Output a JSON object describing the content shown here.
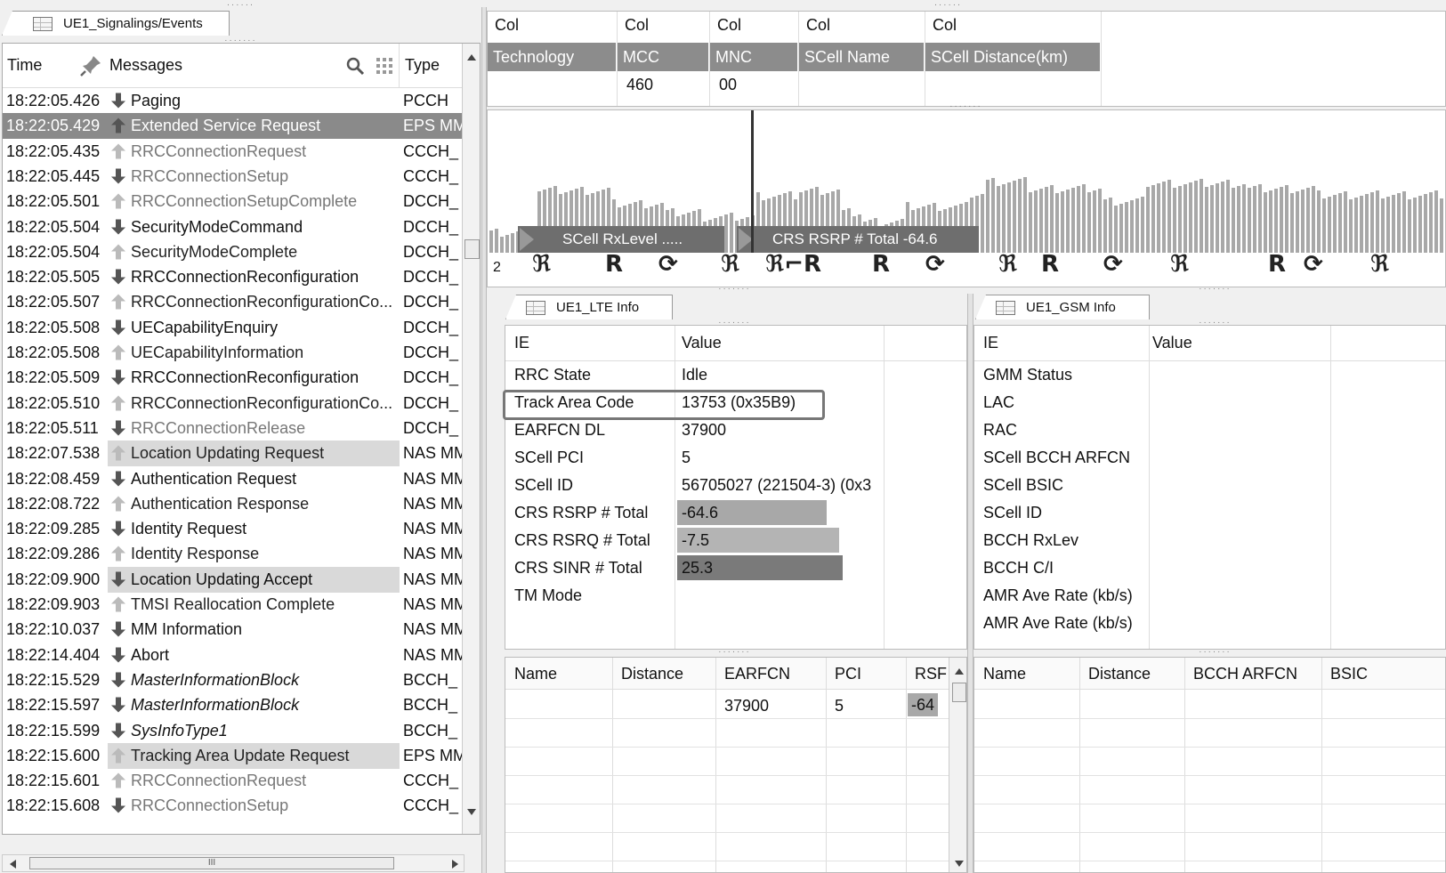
{
  "signaling_panel": {
    "tab_label": "UE1_Signalings/Events",
    "headers": {
      "time": "Time",
      "messages": "Messages",
      "type": "Type"
    },
    "rows": [
      {
        "time": "18:22:05.426",
        "dir": "down",
        "msg": "Paging",
        "type": "PCCH",
        "style": "normal"
      },
      {
        "time": "18:22:05.429",
        "dir": "up",
        "msg": "Extended Service Request",
        "type": "EPS MM",
        "style": "selected"
      },
      {
        "time": "18:22:05.435",
        "dir": "up",
        "msg": "RRCConnectionRequest",
        "type": "CCCH_",
        "style": "grey"
      },
      {
        "time": "18:22:05.445",
        "dir": "down",
        "msg": "RRCConnectionSetup",
        "type": "CCCH_",
        "style": "grey"
      },
      {
        "time": "18:22:05.501",
        "dir": "up",
        "msg": "RRCConnectionSetupComplete",
        "type": "DCCH_",
        "style": "grey"
      },
      {
        "time": "18:22:05.504",
        "dir": "down",
        "msg": "SecurityModeCommand",
        "type": "DCCH_",
        "style": "normal"
      },
      {
        "time": "18:22:05.504",
        "dir": "up",
        "msg": "SecurityModeComplete",
        "type": "DCCH_",
        "style": "normal"
      },
      {
        "time": "18:22:05.505",
        "dir": "down",
        "msg": "RRCConnectionReconfiguration",
        "type": "DCCH_",
        "style": "normal"
      },
      {
        "time": "18:22:05.507",
        "dir": "up",
        "msg": "RRCConnectionReconfigurationCo...",
        "type": "DCCH_",
        "style": "normal"
      },
      {
        "time": "18:22:05.508",
        "dir": "down",
        "msg": "UECapabilityEnquiry",
        "type": "DCCH_",
        "style": "normal"
      },
      {
        "time": "18:22:05.508",
        "dir": "up",
        "msg": "UECapabilityInformation",
        "type": "DCCH_",
        "style": "normal"
      },
      {
        "time": "18:22:05.509",
        "dir": "down",
        "msg": "RRCConnectionReconfiguration",
        "type": "DCCH_",
        "style": "normal"
      },
      {
        "time": "18:22:05.510",
        "dir": "up",
        "msg": "RRCConnectionReconfigurationCo...",
        "type": "DCCH_",
        "style": "normal"
      },
      {
        "time": "18:22:05.511",
        "dir": "down",
        "msg": "RRCConnectionRelease",
        "type": "DCCH_",
        "style": "grey"
      },
      {
        "time": "18:22:07.538",
        "dir": "up",
        "msg": "Location Updating Request",
        "type": "NAS MM",
        "style": "shaded"
      },
      {
        "time": "18:22:08.459",
        "dir": "down",
        "msg": "Authentication Request",
        "type": "NAS MM",
        "style": "normal"
      },
      {
        "time": "18:22:08.722",
        "dir": "up",
        "msg": "Authentication Response",
        "type": "NAS MM",
        "style": "normal"
      },
      {
        "time": "18:22:09.285",
        "dir": "down",
        "msg": "Identity Request",
        "type": "NAS MM",
        "style": "normal"
      },
      {
        "time": "18:22:09.286",
        "dir": "up",
        "msg": "Identity Response",
        "type": "NAS MM",
        "style": "normal"
      },
      {
        "time": "18:22:09.900",
        "dir": "down",
        "msg": "Location Updating Accept",
        "type": "NAS MM",
        "style": "shaded"
      },
      {
        "time": "18:22:09.903",
        "dir": "up",
        "msg": "TMSI Reallocation Complete",
        "type": "NAS MM",
        "style": "normal"
      },
      {
        "time": "18:22:10.037",
        "dir": "down",
        "msg": "MM Information",
        "type": "NAS MM",
        "style": "normal"
      },
      {
        "time": "18:22:14.404",
        "dir": "down",
        "msg": "Abort",
        "type": "NAS MM",
        "style": "normal"
      },
      {
        "time": "18:22:15.529",
        "dir": "down",
        "msg": "MasterInformationBlock",
        "type": "BCCH_",
        "style": "italic"
      },
      {
        "time": "18:22:15.597",
        "dir": "down",
        "msg": "MasterInformationBlock",
        "type": "BCCH_",
        "style": "italic"
      },
      {
        "time": "18:22:15.599",
        "dir": "down",
        "msg": "SysInfoType1",
        "type": "BCCH_",
        "style": "italic"
      },
      {
        "time": "18:22:15.600",
        "dir": "up",
        "msg": "Tracking Area Update Request",
        "type": "EPS MM",
        "style": "shaded"
      },
      {
        "time": "18:22:15.601",
        "dir": "up",
        "msg": "RRCConnectionRequest",
        "type": "CCCH_",
        "style": "grey"
      },
      {
        "time": "18:22:15.608",
        "dir": "down",
        "msg": "RRCConnectionSetup",
        "type": "CCCH_",
        "style": "grey"
      }
    ],
    "hscroll_thumb": "III"
  },
  "cell_table": {
    "col_headers": [
      "Col",
      "Col",
      "Col",
      "Col",
      "Col"
    ],
    "field_headers": [
      "Technology",
      "MCC",
      "MNC",
      "SCell Name",
      "SCell Distance(km)"
    ],
    "values": [
      "",
      "460",
      "00",
      "",
      ""
    ]
  },
  "chart": {
    "legend_1": "SCell RxLevel   .....",
    "legend_2": "CRS RSRP # Total  -64.6",
    "marker_count": "2"
  },
  "lte_panel": {
    "tab_label": "UE1_LTE Info",
    "headers": {
      "ie": "IE",
      "value": "Value"
    },
    "rows": [
      {
        "ie": "RRC State",
        "value": "Idle"
      },
      {
        "ie": "Track Area Code",
        "value": "13753 (0x35B9)"
      },
      {
        "ie": "EARFCN DL",
        "value": "37900"
      },
      {
        "ie": "SCell PCI",
        "value": "5"
      },
      {
        "ie": "SCell ID",
        "value": "56705027 (221504-3) (0x3"
      },
      {
        "ie": "CRS RSRP # Total",
        "value": "-64.6"
      },
      {
        "ie": "CRS RSRQ # Total",
        "value": "-7.5"
      },
      {
        "ie": "CRS SINR # Total",
        "value": "25.3"
      },
      {
        "ie": "TM Mode",
        "value": ""
      }
    ],
    "neighbor_headers": [
      "Name",
      "Distance",
      "EARFCN",
      "PCI",
      "RSF"
    ],
    "neighbor_row": [
      "",
      "",
      "37900",
      "5",
      "-64"
    ]
  },
  "gsm_panel": {
    "tab_label": "UE1_GSM Info",
    "headers": {
      "ie": "IE",
      "value": "Value"
    },
    "rows": [
      "GMM Status",
      "LAC",
      "RAC",
      "SCell BCCH ARFCN",
      "SCell BSIC",
      "SCell ID",
      "BCCH RxLev",
      "BCCH C/I",
      "AMR Ave Rate (kb/s)",
      "AMR Ave Rate (kb/s)"
    ],
    "neighbor_headers": [
      "Name",
      "Distance",
      "BCCH ARFCN",
      "BSIC"
    ]
  },
  "colors": {
    "selected_row": "#8a8a8a",
    "shaded_row": "#d9d9d9",
    "header_dark": "#8c8c8c",
    "chart_bar": "#a8a8a8"
  },
  "icons": {
    "pin": "pin-icon",
    "search": "search-icon",
    "columns": "grid-icon",
    "arrow_up": "arrow-up-icon",
    "arrow_down": "arrow-down-icon"
  }
}
